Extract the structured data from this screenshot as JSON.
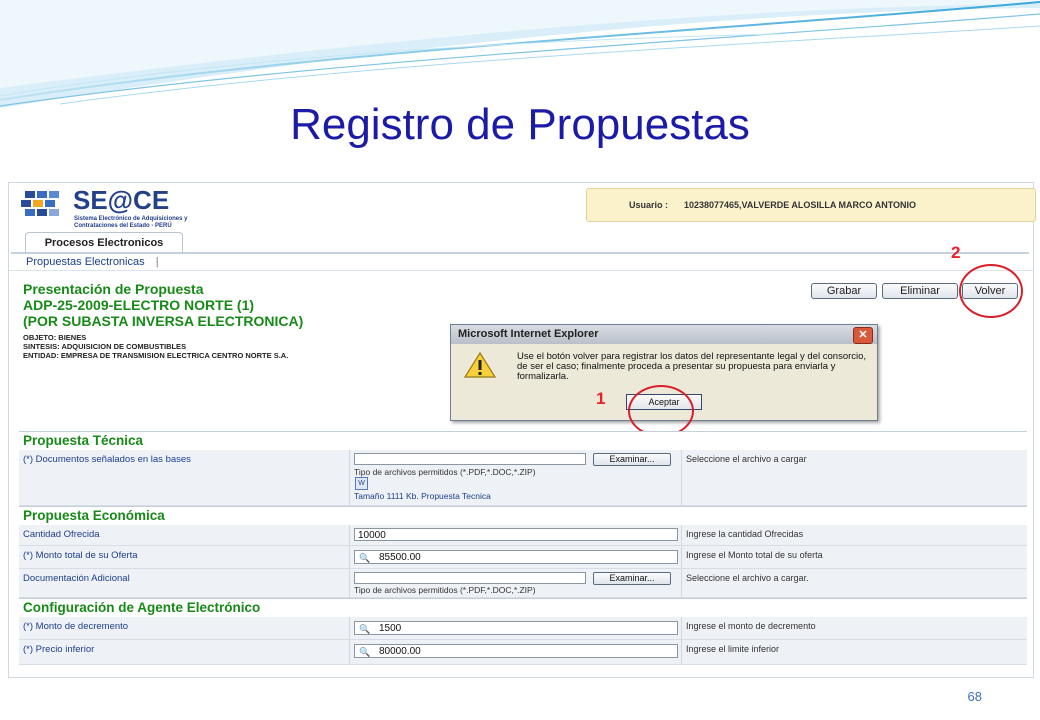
{
  "slide": {
    "title": "Registro de Propuestas",
    "page_number": "68"
  },
  "header": {
    "logo_text": "SE@CE",
    "logo_subtitle": "Sistema Electrónico de Adquisiciones y Contrataciones del Estado - PERÚ",
    "user_label": "Usuario :",
    "user_value": "10238077465,VALVERDE ALOSILLA MARCO ANTONIO"
  },
  "nav": {
    "tab": "Procesos Electronicos",
    "subnav": "Propuestas Electronicas",
    "subnav_sep": "|"
  },
  "proposal": {
    "heading": "Presentación de Propuesta",
    "code": "ADP-25-2009-ELECTRO NORTE (1)",
    "modality": "(POR SUBASTA INVERSA ELECTRONICA)",
    "objeto": "OBJETO: BIENES",
    "sintesis": "SINTESIS: ADQUISICION DE COMBUSTIBLES",
    "entidad": "ENTIDAD: EMPRESA DE TRANSMISION ELECTRICA CENTRO NORTE S.A."
  },
  "toolbar": {
    "grabar": "Grabar",
    "eliminar": "Eliminar",
    "volver": "Volver"
  },
  "dialog": {
    "title": "Microsoft Internet Explorer",
    "close": "✕",
    "message": "Use el botón volver para registrar los datos del representante legal y del consorcio, de ser el caso; finalmente proceda a presentar su propuesta para enviarla y formalizarla.",
    "ok": "Aceptar"
  },
  "annotations": {
    "one": "1",
    "two": "2"
  },
  "tecnica": {
    "heading": "Propuesta Técnica",
    "docs_label": "(*) Documentos señalados en las bases",
    "examinar": "Examinar...",
    "types": "Tipo de archivos permitidos (*.PDF,*.DOC,*.ZIP)",
    "file_link": "Tamaño 1111 Kb.  Propuesta Tecnica",
    "hint": "Seleccione el archivo a cargar"
  },
  "economica": {
    "heading": "Propuesta Económica",
    "cantidad_label": "Cantidad Ofrecida",
    "cantidad_value": "10000",
    "cantidad_hint": "Ingrese la cantidad Ofrecidas",
    "monto_label": "(*) Monto total de su Oferta",
    "monto_value": "85500.00",
    "monto_hint": "Ingrese el Monto total de su oferta",
    "doc_label": "Documentación Adicional",
    "examinar": "Examinar...",
    "types": "Tipo de archivos permitidos (*.PDF,*.DOC,*.ZIP)",
    "doc_hint": "Seleccione el archivo a cargar."
  },
  "agente": {
    "heading": "Configuración de Agente Electrónico",
    "decremento_label": "(*) Monto de decremento",
    "decremento_value": "1500",
    "decremento_hint": "Ingrese el monto de decremento",
    "precio_label": "(*) Precio inferior",
    "precio_value": "80000.00",
    "precio_hint": "Ingrese el limite inferior"
  },
  "colors": {
    "slide_title": "#1b1ba8",
    "section_green": "#188a18",
    "annotation_red": "#e8202a",
    "link_blue": "#1e3f8f"
  }
}
